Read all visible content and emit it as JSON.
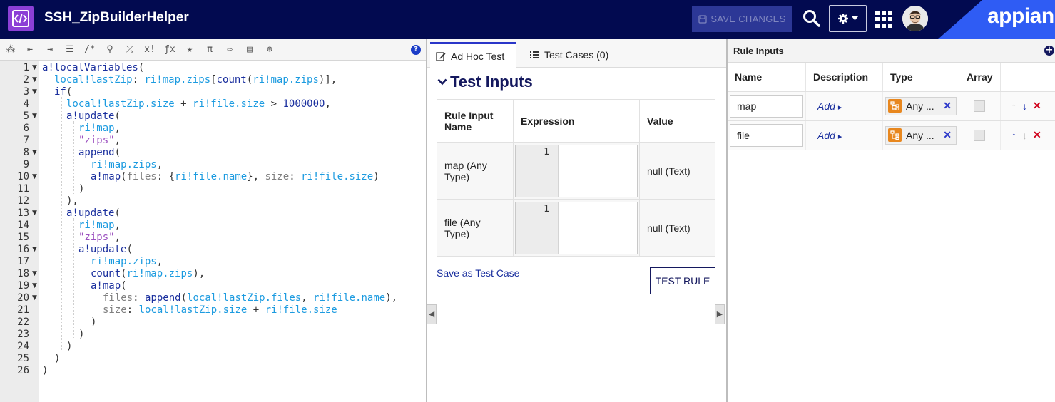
{
  "header": {
    "title": "SSH_ZipBuilderHelper",
    "save_label": "SAVE CHANGES",
    "brand": "appian",
    "icons": [
      "code-icon",
      "search-icon",
      "gear-icon",
      "grid-icon",
      "avatar"
    ]
  },
  "toolbar": {
    "icons": [
      "magic-wand-icon",
      "outdent-icon",
      "indent-icon",
      "list-icon",
      "comment-icon",
      "search-icon",
      "shuffle-icon",
      "x-factorial-icon",
      "fx-icon",
      "star-icon",
      "pi-icon",
      "export-icon",
      "db-search-icon",
      "globe-icon",
      "help-icon"
    ],
    "tokens": [
      "⁂",
      "⇤",
      "⇥",
      "☰",
      "/*",
      "⚲",
      "⤮",
      "x!",
      "ƒx",
      "★",
      "π",
      "⇨",
      "▤",
      "⊕"
    ],
    "help": "?"
  },
  "code": {
    "lines": [
      {
        "n": "1",
        "fold": true
      },
      {
        "n": "2",
        "fold": true
      },
      {
        "n": "3",
        "fold": true
      },
      {
        "n": "4",
        "fold": false
      },
      {
        "n": "5",
        "fold": true
      },
      {
        "n": "6",
        "fold": false
      },
      {
        "n": "7",
        "fold": false
      },
      {
        "n": "8",
        "fold": true
      },
      {
        "n": "9",
        "fold": false
      },
      {
        "n": "10",
        "fold": true
      },
      {
        "n": "11",
        "fold": false
      },
      {
        "n": "12",
        "fold": false
      },
      {
        "n": "13",
        "fold": true
      },
      {
        "n": "14",
        "fold": false
      },
      {
        "n": "15",
        "fold": false
      },
      {
        "n": "16",
        "fold": true
      },
      {
        "n": "17",
        "fold": false
      },
      {
        "n": "18",
        "fold": true
      },
      {
        "n": "19",
        "fold": true
      },
      {
        "n": "20",
        "fold": true
      },
      {
        "n": "21",
        "fold": false
      },
      {
        "n": "22",
        "fold": false
      },
      {
        "n": "23",
        "fold": false
      },
      {
        "n": "24",
        "fold": false
      },
      {
        "n": "25",
        "fold": false
      },
      {
        "n": "26",
        "fold": false
      }
    ],
    "tokens": {
      "l1": [
        "a!localVariables",
        "("
      ],
      "l2": [
        "local!lastZip",
        ": ",
        "ri!map.zips",
        "[",
        "count",
        "(",
        "ri!map.zips",
        ")],"
      ],
      "l3": [
        "if",
        "("
      ],
      "l4": [
        "local!lastZip.size",
        " + ",
        "ri!file.size",
        " > ",
        "1000000",
        ","
      ],
      "l5": [
        "a!update",
        "("
      ],
      "l6": [
        "ri!map",
        ","
      ],
      "l7": [
        "\"zips\"",
        ","
      ],
      "l8": [
        "append",
        "("
      ],
      "l9": [
        "ri!map.zips",
        ","
      ],
      "l10": [
        "a!map",
        "(",
        "files",
        ": {",
        "ri!file.name",
        "}, ",
        "size",
        ": ",
        "ri!file.size",
        ")"
      ],
      "l11": [
        ")"
      ],
      "l12": [
        "),"
      ],
      "l13": [
        "a!update",
        "("
      ],
      "l14": [
        "ri!map",
        ","
      ],
      "l15": [
        "\"zips\"",
        ","
      ],
      "l16": [
        "a!update",
        "("
      ],
      "l17": [
        "ri!map.zips",
        ","
      ],
      "l18": [
        "count",
        "(",
        "ri!map.zips",
        "),"
      ],
      "l19": [
        "a!map",
        "("
      ],
      "l20": [
        "files",
        ": ",
        "append",
        "(",
        "local!lastZip.files",
        ", ",
        "ri!file.name",
        "),"
      ],
      "l21": [
        "size",
        ": ",
        "local!lastZip.size",
        " + ",
        "ri!file.size"
      ],
      "l22": [
        ")"
      ],
      "l23": [
        ")"
      ],
      "l24": [
        ")"
      ],
      "l25": [
        ")"
      ],
      "l26": [
        ")"
      ]
    }
  },
  "mid": {
    "tabs": [
      {
        "label": "Ad Hoc Test",
        "active": true
      },
      {
        "label": "Test Cases (0)",
        "active": false
      }
    ],
    "section_title": "Test Inputs",
    "table": {
      "headers": [
        "Rule Input Name",
        "Expression",
        "Value"
      ],
      "rows": [
        {
          "name": "map (Any Type)",
          "expr_line": "1",
          "value": "null (Text)"
        },
        {
          "name": "file (Any Type)",
          "expr_line": "1",
          "value": "null (Text)"
        }
      ]
    },
    "save_link": "Save as Test Case",
    "test_button": "TEST RULE"
  },
  "right": {
    "title": "Rule Inputs",
    "add": "+",
    "headers": [
      "Name",
      "Description",
      "Type",
      "Array"
    ],
    "rows": [
      {
        "name": "map",
        "desc": "Add",
        "type": "Any ...",
        "up_enabled": false,
        "down_enabled": true
      },
      {
        "name": "file",
        "desc": "Add",
        "type": "Any ...",
        "up_enabled": true,
        "down_enabled": false
      }
    ],
    "caret": "▸",
    "remove": "✕",
    "up": "↑",
    "down": "↓"
  },
  "colors": {
    "header_bg": "#020a50",
    "brand_blue": "#2f5cf4",
    "accent": "#2a36c9",
    "function": "#1a2f9e",
    "rule_input": "#1c9be0",
    "string": "#9b4fbf"
  }
}
